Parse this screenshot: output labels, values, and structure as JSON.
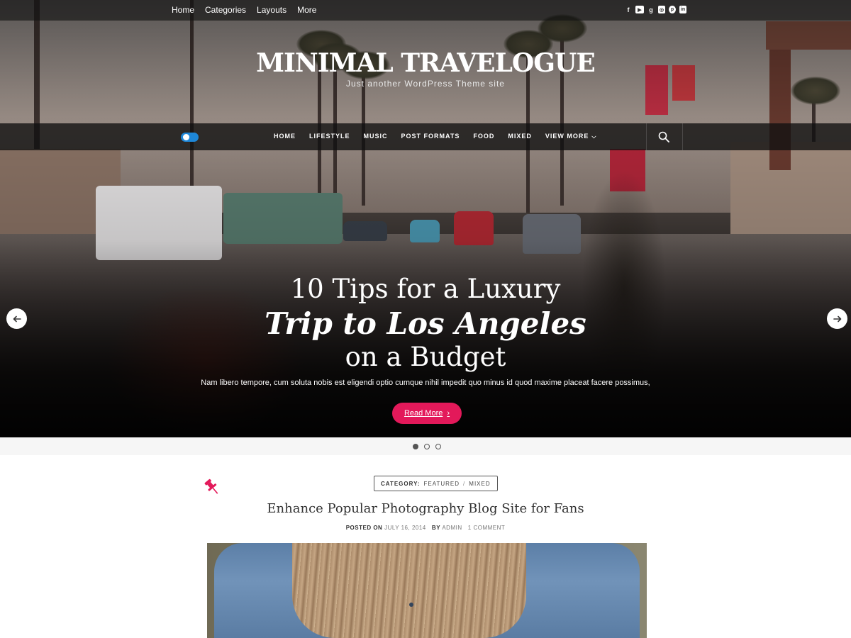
{
  "topbar": {
    "nav": [
      "Home",
      "Categories",
      "Layouts",
      "More"
    ],
    "socials": [
      "facebook-icon",
      "youtube-icon",
      "google-plus-icon",
      "instagram-icon",
      "pinterest-icon",
      "linkedin-icon"
    ]
  },
  "branding": {
    "title": "Minimal Travelogue",
    "tagline": "Just another WordPress Theme site"
  },
  "mainnav": {
    "items": [
      "HOME",
      "LIFESTYLE",
      "MUSIC",
      "POST FORMATS",
      "FOOD",
      "MIXED",
      "VIEW MORE"
    ]
  },
  "slider": {
    "line1": "10 Tips for a Luxury",
    "line2": "Trip to Los Angeles",
    "line3": "on a Budget",
    "excerpt": "Nam libero tempore, cum soluta nobis est eligendi optio cumque nihil impedit quo minus id quod maxime placeat facere possimus,",
    "read_more": "Read More",
    "current_slide": 1,
    "total_slides": 3
  },
  "post": {
    "category_label": "CATEGORY:",
    "categories": [
      "FEATURED",
      "MIXED"
    ],
    "category_sep": "/",
    "title": "Enhance Popular Photography Blog Site for Fans",
    "posted_on_label": "POSTED ON",
    "date": "JULY 16, 2014",
    "by_label": "BY",
    "author": "ADMIN",
    "comments": "1 COMMENT"
  },
  "colors": {
    "accent": "#e3195a",
    "toggle": "#1e87d8"
  }
}
